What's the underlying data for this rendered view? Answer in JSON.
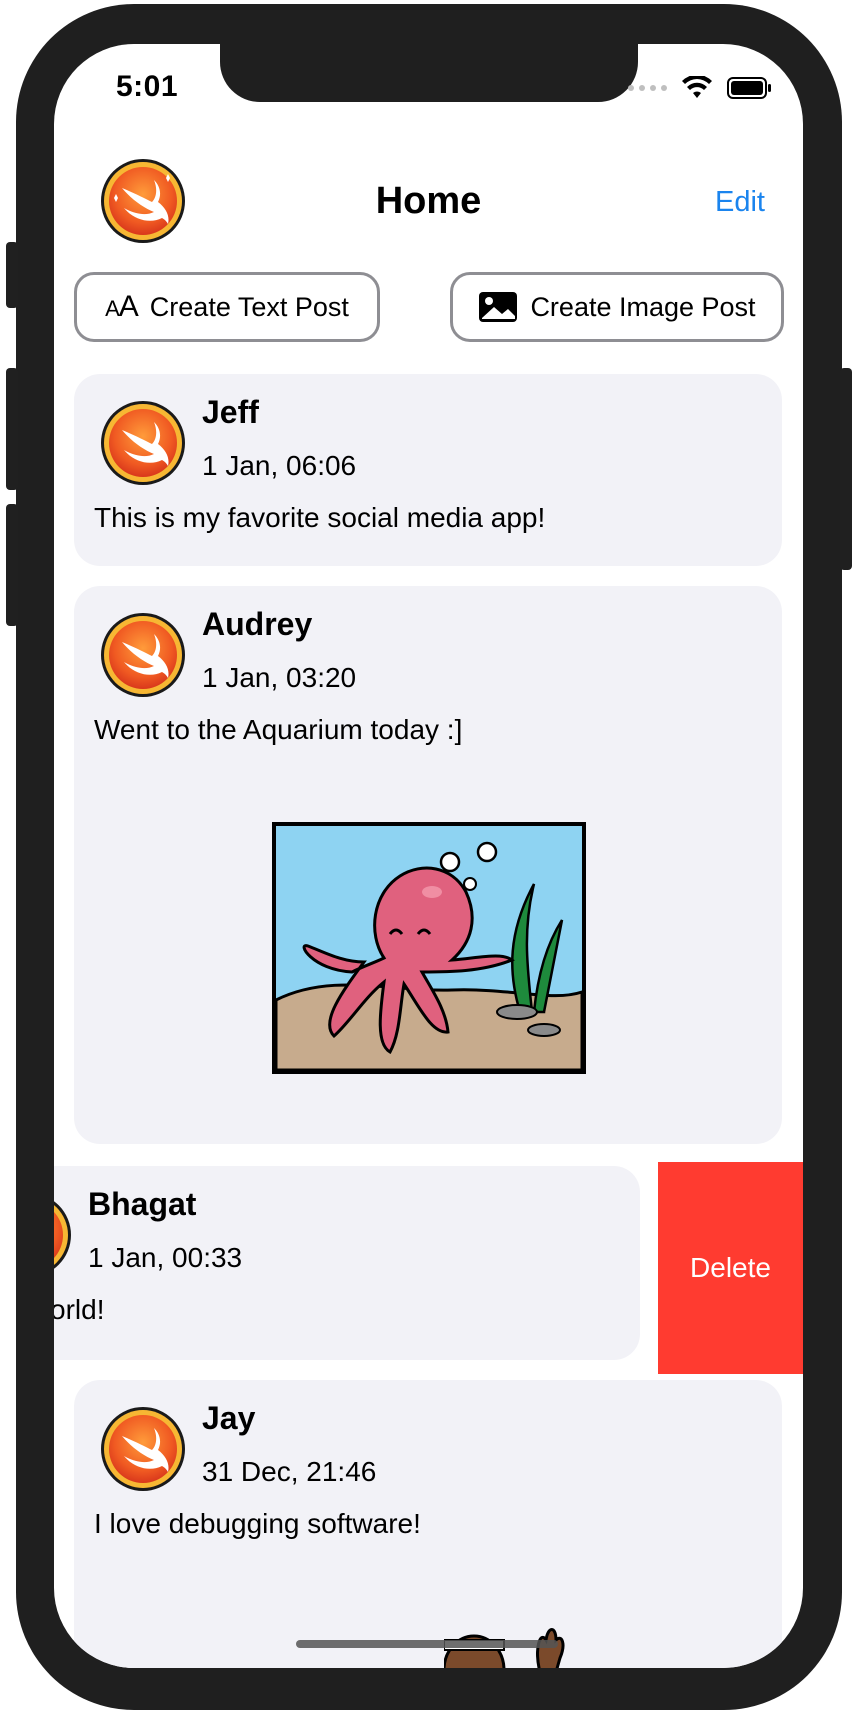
{
  "status_bar": {
    "time": "5:01"
  },
  "header": {
    "title": "Home",
    "edit_label": "Edit"
  },
  "actions": {
    "text_post_label": "Create Text Post",
    "image_post_label": "Create Image Post"
  },
  "posts": [
    {
      "author": "Jeff",
      "date": "1 Jan, 06:06",
      "text": "This is my favorite social media app!"
    },
    {
      "author": "Audrey",
      "date": "1 Jan, 03:20",
      "text": "Went to the Aquarium today :]"
    },
    {
      "author": "Bhagat",
      "date": "1 Jan, 00:33",
      "text": "orld!"
    },
    {
      "author": "Jay",
      "date": "31 Dec, 21:46",
      "text": "I love debugging software!"
    }
  ],
  "swipe_action": {
    "delete_label": "Delete"
  },
  "colors": {
    "accent": "#1a84ee",
    "delete": "#ff3b30",
    "card": "#f2f2f7"
  },
  "icons": [
    "swift-logo-icon",
    "text-size-icon",
    "photo-icon",
    "wifi-icon",
    "battery-icon",
    "cellular-icon"
  ]
}
